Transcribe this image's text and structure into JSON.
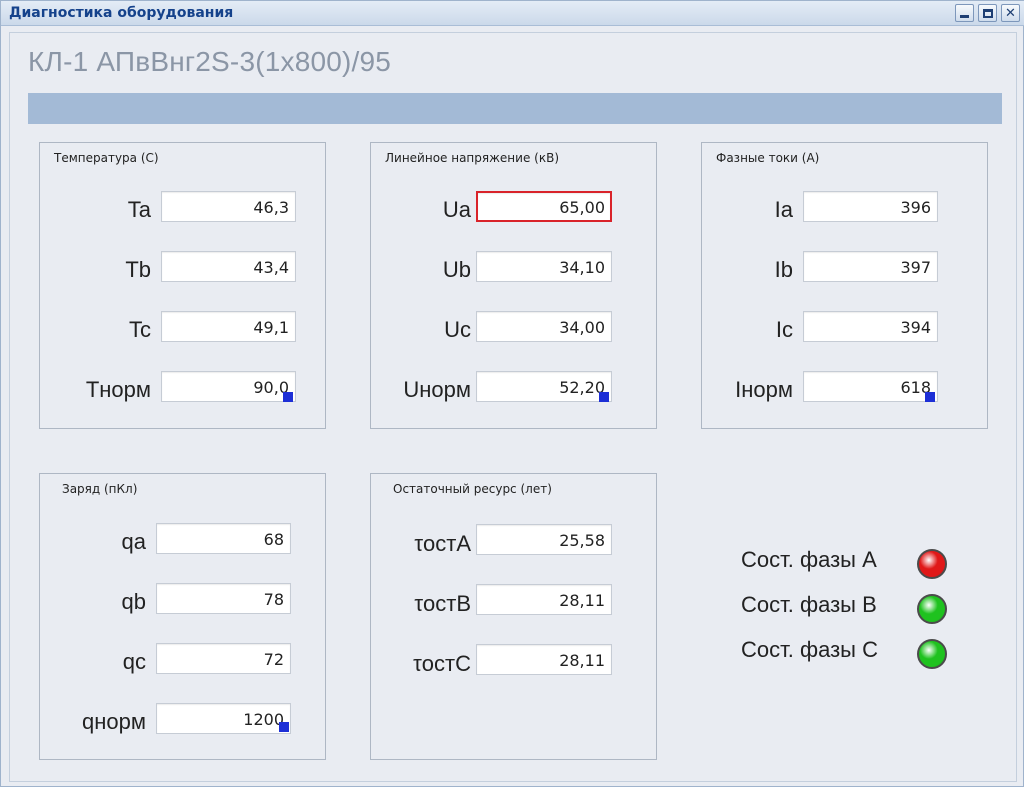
{
  "window": {
    "title": "Диагностика оборудования"
  },
  "cable_title": "КЛ-1 АПвВнг2S-3(1x800)/95",
  "colors": {
    "alert_border": "#d9232a",
    "status_red": "#e01818",
    "status_green": "#1fc21f"
  },
  "groups": {
    "temperature": {
      "label": "Температура (С)",
      "rows": [
        {
          "label": "Ta",
          "value": "46,3"
        },
        {
          "label": "Tb",
          "value": "43,4"
        },
        {
          "label": "Tc",
          "value": "49,1"
        },
        {
          "label": "Tнорм",
          "value": "90,0"
        }
      ]
    },
    "voltage": {
      "label": "Линейное напряжение (кВ)",
      "rows": [
        {
          "label": "Ua",
          "value": "65,00"
        },
        {
          "label": "Ub",
          "value": "34,10"
        },
        {
          "label": "Uc",
          "value": "34,00"
        },
        {
          "label": "Uнорм",
          "value": "52,20"
        }
      ]
    },
    "current": {
      "label": "Фазные токи (А)",
      "rows": [
        {
          "label": "Ia",
          "value": "396"
        },
        {
          "label": "Ib",
          "value": "397"
        },
        {
          "label": "Ic",
          "value": "394"
        },
        {
          "label": "Iнорм",
          "value": "618"
        }
      ]
    },
    "charge": {
      "label": "Заряд (пКл)",
      "rows": [
        {
          "label": "qa",
          "value": "68"
        },
        {
          "label": "qb",
          "value": "78"
        },
        {
          "label": "qc",
          "value": "72"
        },
        {
          "label": "qнорм",
          "value": "1200"
        }
      ]
    },
    "resource": {
      "label": "Остаточный ресурс (лет)",
      "rows": [
        {
          "label": "τостA",
          "value": "25,58"
        },
        {
          "label": "τостB",
          "value": "28,11"
        },
        {
          "label": "τостC",
          "value": "28,11"
        }
      ]
    }
  },
  "phase_status": [
    {
      "label": "Сост. фазы A",
      "state": "red"
    },
    {
      "label": "Сост. фазы B",
      "state": "green"
    },
    {
      "label": "Сост. фазы C",
      "state": "green"
    }
  ]
}
